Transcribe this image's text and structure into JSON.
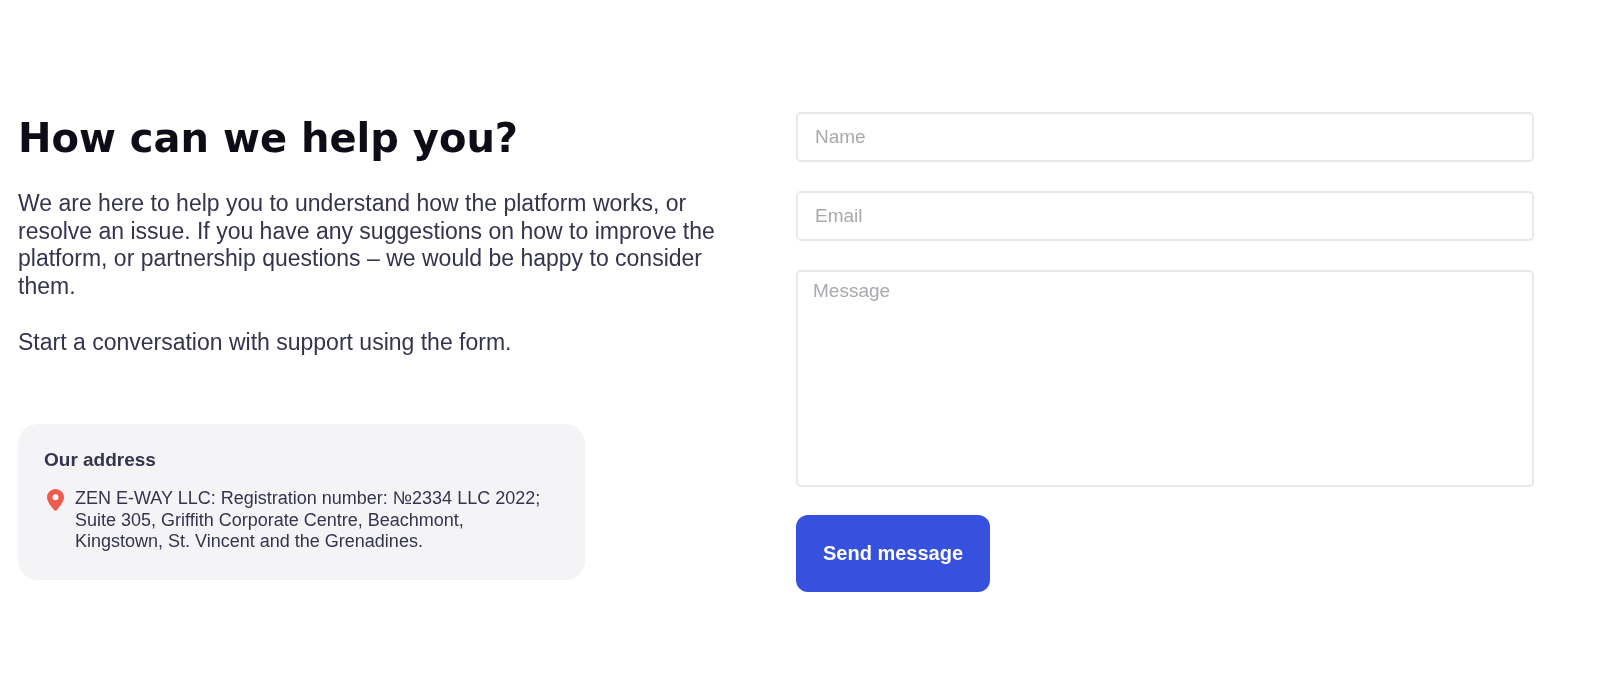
{
  "heading": "How can we help you?",
  "intro": [
    "We are here to help you to understand how the platform works, or resolve an issue. If you have any suggestions on how to improve the platform, or partnership questions – we would be happy to consider them.",
    "Start a conversation with support using the form."
  ],
  "address_card": {
    "title": "Our address",
    "text": "ZEN E-WAY LLC: Registration number: №2334 LLC 2022; Suite 305, Griffith Corporate Centre, Beachmont, Kingstown, St. Vincent and the Grenadines."
  },
  "form": {
    "fields": [
      {
        "kind": "input",
        "placeholder": "Name"
      },
      {
        "kind": "input",
        "placeholder": "Email"
      },
      {
        "kind": "textarea",
        "placeholder": "Message"
      }
    ],
    "submit": "Send message"
  }
}
